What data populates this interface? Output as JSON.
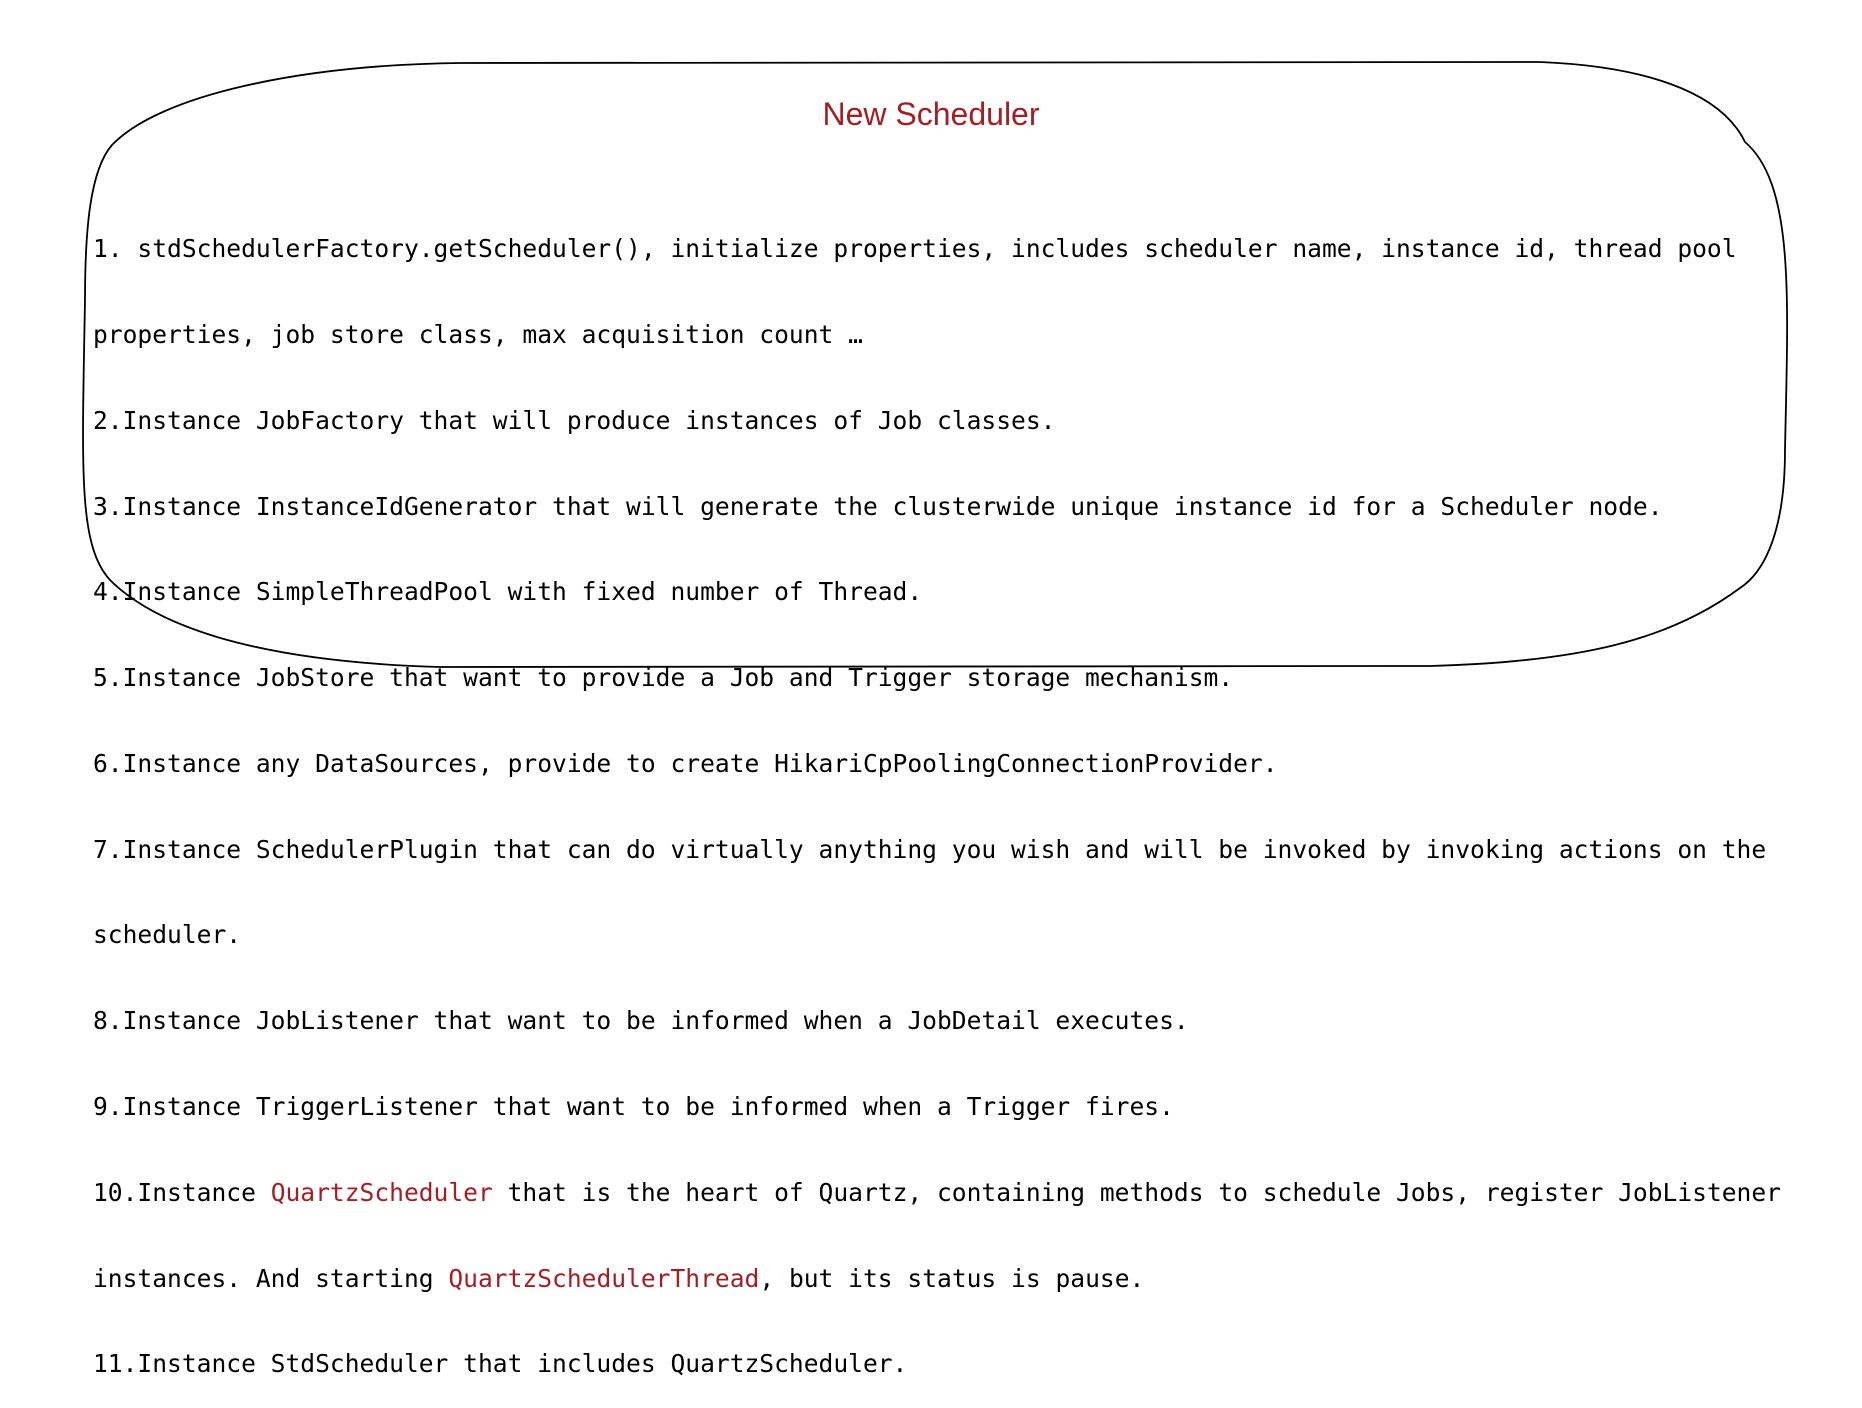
{
  "title": "New Scheduler",
  "colors": {
    "title": "#a31f24",
    "highlight": "#a31f24",
    "text": "#000000",
    "outline": "#000000"
  },
  "lines": [
    "1. stdSchedulerFactory.getScheduler(), initialize properties, includes scheduler name, instance id, thread pool",
    "properties, job store class, max acquisition count …",
    "2.Instance JobFactory that will produce instances of Job classes.",
    "3.Instance InstanceIdGenerator that will generate the clusterwide unique instance id for a Scheduler node.",
    "4.Instance SimpleThreadPool with fixed number of Thread.",
    "5.Instance JobStore that want to provide a Job and Trigger storage mechanism.",
    "6.Instance any DataSources, provide to create HikariCpPoolingConnectionProvider.",
    "7.Instance SchedulerPlugin that can do virtually anything you wish and will be invoked by invoking actions on the",
    "scheduler.",
    "8.Instance JobListener that want to be informed when a JobDetail executes.",
    "9.Instance TriggerListener that want to be informed when a Trigger fires."
  ],
  "item10": {
    "prefix": "10.Instance ",
    "highlight1": "QuartzScheduler",
    "middle": " that is the heart of Quartz, containing methods to schedule Jobs, register JobListener",
    "line2_prefix": "instances. And starting ",
    "highlight2": "QuartzSchedulerThread",
    "line2_suffix": ", but its status is pause."
  },
  "item11": "11.Instance StdScheduler that includes QuartzScheduler."
}
